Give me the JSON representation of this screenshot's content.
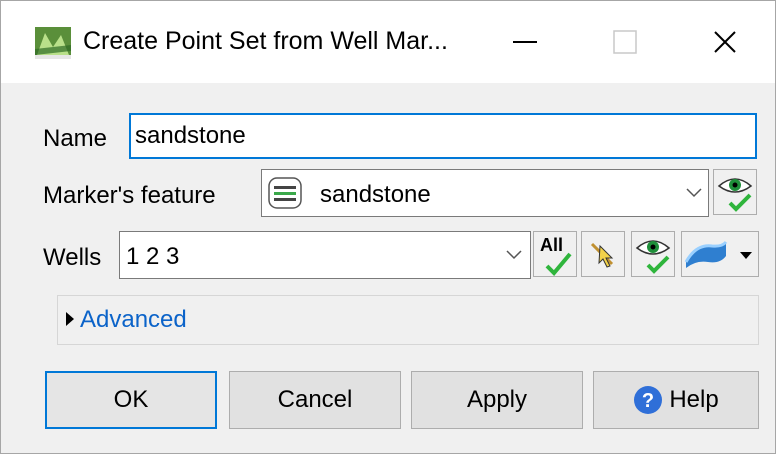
{
  "window": {
    "title": "Create Point Set from Well Mar...",
    "app_icon": "map-icon"
  },
  "form": {
    "name_label": "Name",
    "name_value": "sandstone",
    "marker_label": "Marker's feature",
    "marker_value": "sandstone",
    "marker_icon": "feature-layer-icon",
    "wells_label": "Wells",
    "wells_value": "1 2 3",
    "wells_tools": [
      "select-all-icon",
      "pick-cursor-icon",
      "visibility-icon",
      "surface-icon"
    ],
    "all_text": "All"
  },
  "advanced": {
    "label": "Advanced"
  },
  "buttons": {
    "ok": "OK",
    "cancel": "Cancel",
    "apply": "Apply",
    "help": "Help"
  },
  "colors": {
    "accent": "#0078d7",
    "link": "#0b63c9",
    "check_green": "#3fbf3f"
  }
}
